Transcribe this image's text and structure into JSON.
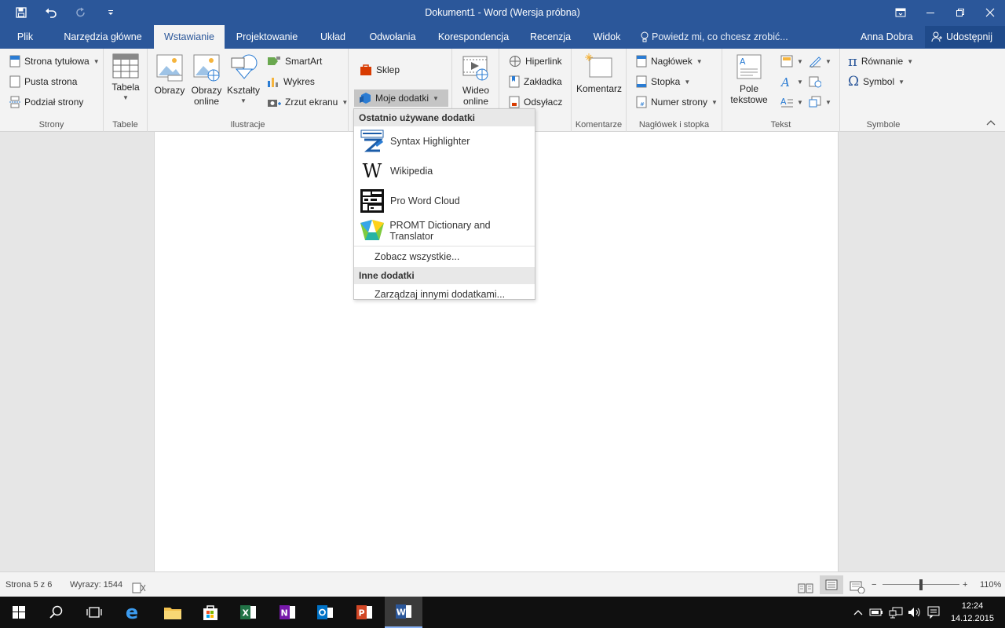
{
  "window": {
    "title": "Dokument1 - Word (Wersja próbna)"
  },
  "tabs": [
    {
      "label": "Plik",
      "active": false
    },
    {
      "label": "Narzędzia główne",
      "active": false
    },
    {
      "label": "Wstawianie",
      "active": true
    },
    {
      "label": "Projektowanie",
      "active": false
    },
    {
      "label": "Układ",
      "active": false
    },
    {
      "label": "Odwołania",
      "active": false
    },
    {
      "label": "Korespondencja",
      "active": false
    },
    {
      "label": "Recenzja",
      "active": false
    },
    {
      "label": "Widok",
      "active": false
    }
  ],
  "tell_me": "Powiedz mi, co chcesz zrobić...",
  "user_name": "Anna Dobra",
  "share_label": "Udostępnij",
  "ribbon": {
    "strony": {
      "label": "Strony",
      "items": [
        "Strona tytułowa",
        "Pusta strona",
        "Podział strony"
      ]
    },
    "tabele": {
      "label": "Tabele",
      "tabela": "Tabela"
    },
    "ilustracje": {
      "label": "Ilustracje",
      "obrazy": "Obrazy",
      "obrazy_online_1": "Obrazy",
      "obrazy_online_2": "online",
      "ksztalty": "Kształty",
      "smartart": "SmartArt",
      "wykres": "Wykres",
      "zrzut": "Zrzut ekranu"
    },
    "dodatki": {
      "sklep": "Sklep",
      "moje_dodatki": "Moje dodatki",
      "label_partial": "nki"
    },
    "multimedia": {
      "wideo_1": "Wideo",
      "wideo_2": "online"
    },
    "linki": {
      "hiperlink": "Hiperlink",
      "zakladka": "Zakładka",
      "odsylacz": "Odsyłacz"
    },
    "komentarze": {
      "label": "Komentarze",
      "komentarz": "Komentarz"
    },
    "naglowek": {
      "label": "Nagłówek i stopka",
      "naglowek": "Nagłówek",
      "stopka": "Stopka",
      "numer": "Numer strony"
    },
    "tekst": {
      "label": "Tekst",
      "pole_1": "Pole",
      "pole_2": "tekstowe"
    },
    "symbole": {
      "label": "Symbole",
      "rownanie": "Równanie",
      "symbol": "Symbol"
    }
  },
  "menu": {
    "recent_header": "Ostatnio używane dodatki",
    "recent_items": [
      {
        "label": "Syntax Highlighter",
        "icon": "syntax-highlighter-icon"
      },
      {
        "label": "Wikipedia",
        "icon": "wikipedia-icon"
      },
      {
        "label": "Pro Word Cloud",
        "icon": "pro-word-cloud-icon"
      },
      {
        "label": "PROMT Dictionary and Translator",
        "icon": "promt-icon"
      }
    ],
    "see_all": "Zobacz wszystkie...",
    "other_header": "Inne dodatki",
    "manage": "Zarządzaj innymi dodatkami..."
  },
  "status": {
    "page": "Strona 5 z 6",
    "words": "Wyrazy: 1544",
    "zoom": "110%"
  },
  "clock": {
    "time": "12:24",
    "date": "14.12.2015"
  },
  "colors": {
    "accent": "#2b579a",
    "ribbon": "#f3f3f3"
  }
}
